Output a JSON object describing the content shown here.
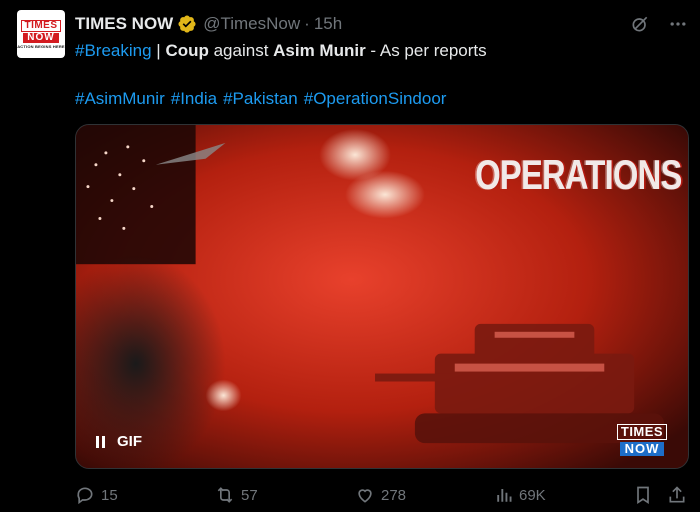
{
  "author": {
    "avatar_text_top": "TIMES",
    "avatar_text_bottom": "NOW",
    "avatar_tagline": "ACTION BEGINS HERE",
    "name": "TIMES NOW",
    "handle": "@TimesNow",
    "separator": "·",
    "time": "15h"
  },
  "tweet": {
    "hashtag_breaking": "#Breaking",
    "pipe": " | ",
    "word_coup": "Coup",
    "word_against": " against ",
    "word_asim": "Asim Munir",
    "rest": " - As per reports",
    "hashtags": [
      "#AsimMunir",
      "#India",
      "#Pakistan",
      "#OperationSindoor"
    ]
  },
  "media": {
    "overlay_text": "OPERATIONS",
    "gif_label": "GIF",
    "logo_top": "TIMES",
    "logo_bottom": "NOW"
  },
  "actions": {
    "replies": "15",
    "reposts": "57",
    "likes": "278",
    "views": "69K"
  },
  "colors": {
    "background": "#000000",
    "text": "#e7e9ea",
    "muted": "#71767b",
    "link": "#1d9bf0",
    "verified_gold": "#e2b719",
    "brand_red": "#d31b20"
  },
  "icons": {
    "verified": "gold-verified-badge-icon",
    "grok": "grok-icon",
    "more": "more-dots-icon",
    "reply": "reply-icon",
    "repost": "repost-icon",
    "like": "heart-icon",
    "views": "views-chart-icon",
    "bookmark": "bookmark-icon",
    "share": "share-icon"
  }
}
